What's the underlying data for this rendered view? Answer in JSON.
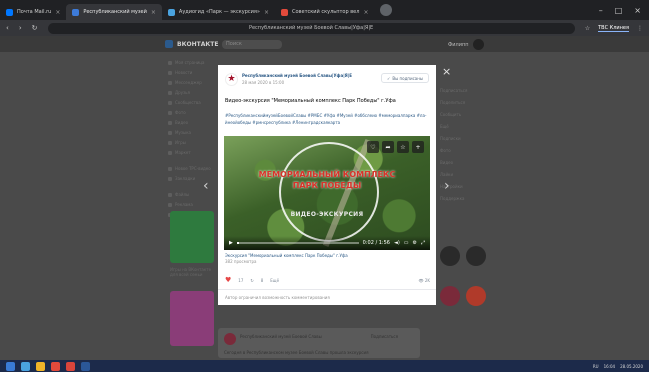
{
  "browser": {
    "tabs": [
      {
        "label": "Почта Mail.ru",
        "color": "#0077ff"
      },
      {
        "label": "Республиканский музей",
        "color": "#3d7bd9",
        "active": true
      },
      {
        "label": "Аудиогид «Парк — экскурсия»",
        "color": "#4aa3df"
      },
      {
        "label": "Советский скульптор вел",
        "color": "#e24a3b"
      }
    ],
    "address": "Республиканский музей Боевой Славы|Уфа|Я|Е",
    "ext_label": "ТВС Клинея"
  },
  "vk": {
    "logo": "ВКОНТАКТЕ",
    "search_placeholder": "Поиск",
    "user_name": "Филипп",
    "sidebar": [
      "Моя страница",
      "Новости",
      "Мессенджер",
      "Друзья",
      "Сообщества",
      "Фото",
      "Видео",
      "Музыка",
      "Игры",
      "Маркет",
      "Новое ТРС-видео",
      "Закладки",
      "Файлы",
      "Реклама",
      "Мини-приложения"
    ],
    "promo1_text": "Игры на ВКонтакте для всей семьи",
    "promo2_text": "Мы делаем все для наших игр",
    "right_items": [
      "Подписаться",
      "Поделиться",
      "Сообщить",
      "Ещё",
      "Подписки",
      "Фото",
      "Видео",
      "Лайки",
      "Настройки",
      "Поддержка"
    ],
    "feed_author": "Республиканский музей Боевой Славы",
    "feed_subscribe": "Подписаться",
    "feed_body": "Сегодня в Республиканском музее Боевой Славы прошла экскурсия"
  },
  "post": {
    "author": "Республиканский музей Боевой Славы|Уфа|Я|Е",
    "date": "28 мая 2020 в 15:00",
    "subscribe_label": "Вы подписаны",
    "title": "Видео-экскурсия \"Мемориальный комплекс Парк Победы\" г.Уфа",
    "hashtags": "#РеспубликанскиймузейБоевойСлавы #РМБС #Уфа #Музей #оббслеио #мемориалпарка #ла-йнеойобеды #рмнсреспублика #Ленинградскаякарта",
    "video": {
      "line1": "МЕМОРИАЛЬНЫЙ КОМПЛЕКС",
      "line2": "ПАРК ПОБЕДЫ",
      "line3": "ВИДЕО-ЭКСКУРСИЯ",
      "time": "0:02 / 1:56",
      "progress": 0.02
    },
    "video_title": "Экскурсия \"Мемориальный комплекс Парк Победы\" г.Уфа",
    "video_views": "382 просмотра",
    "likes": "17",
    "reposts": "8",
    "more": "Ещё",
    "views": "2K",
    "footer_note": "Автор ограничил возможность комментирования"
  },
  "taskbar": {
    "time": "16:04",
    "date": "28.05.2020",
    "lang": "RU"
  }
}
